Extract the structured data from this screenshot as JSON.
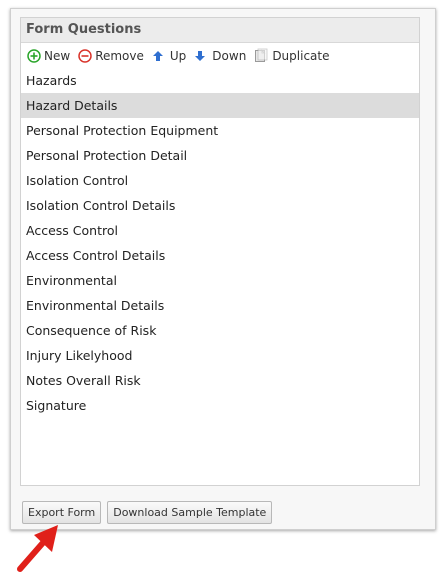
{
  "panel": {
    "title": "Form Questions"
  },
  "toolbar": {
    "new_label": "New",
    "remove_label": "Remove",
    "up_label": "Up",
    "down_label": "Down",
    "duplicate_label": "Duplicate"
  },
  "questions": [
    {
      "label": "Hazards",
      "selected": false
    },
    {
      "label": "Hazard Details",
      "selected": true
    },
    {
      "label": "Personal Protection Equipment",
      "selected": false
    },
    {
      "label": "Personal Protection Detail",
      "selected": false
    },
    {
      "label": "Isolation Control",
      "selected": false
    },
    {
      "label": "Isolation Control Details",
      "selected": false
    },
    {
      "label": "Access Control",
      "selected": false
    },
    {
      "label": "Access Control Details",
      "selected": false
    },
    {
      "label": "Environmental",
      "selected": false
    },
    {
      "label": "Environmental Details",
      "selected": false
    },
    {
      "label": "Consequence of Risk",
      "selected": false
    },
    {
      "label": "Injury Likelyhood",
      "selected": false
    },
    {
      "label": "Notes Overall Risk",
      "selected": false
    },
    {
      "label": "Signature",
      "selected": false
    }
  ],
  "buttons": {
    "export_label": "Export Form",
    "download_label": "Download Sample Template"
  },
  "colors": {
    "add_green": "#2aa52a",
    "remove_red": "#d9342b",
    "arrow_blue": "#2f6fd0",
    "annotation_red": "#e0201a",
    "selected_row": "#dcdcdc"
  }
}
